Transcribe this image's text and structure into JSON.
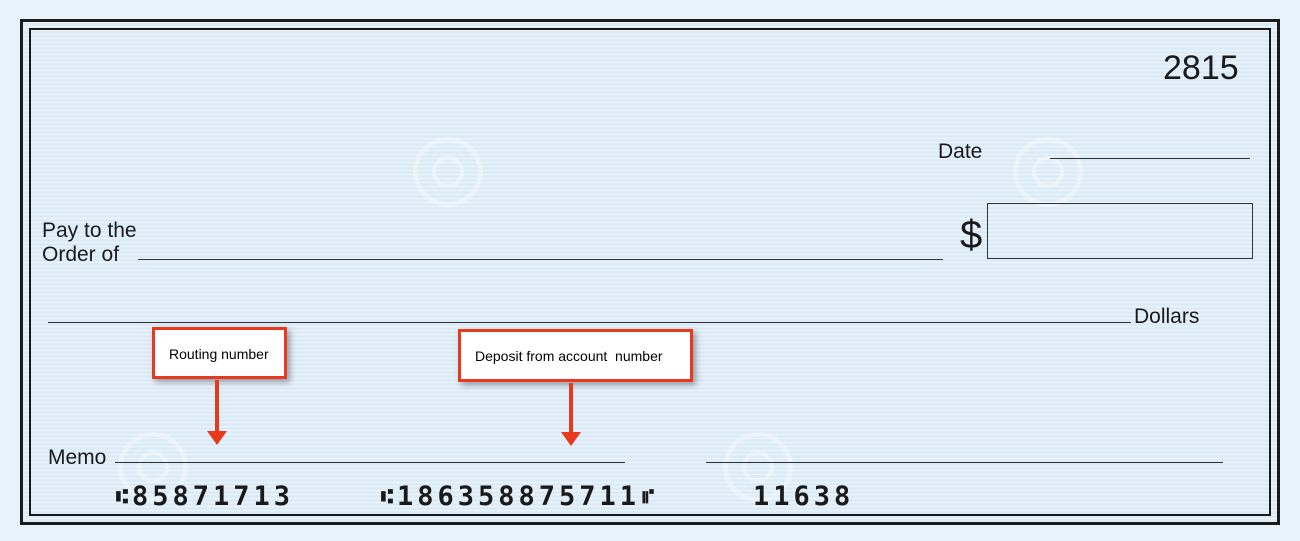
{
  "check": {
    "number": "2815",
    "date_label": "Date",
    "payee_label_line1": "Pay to the",
    "payee_label_line2": "Order of",
    "currency_symbol": "$",
    "dollars_label": "Dollars",
    "memo_label": "Memo"
  },
  "micr": {
    "routing": "85871713",
    "account": "186358875711",
    "check_number": "11638",
    "transit_symbol": "⑆",
    "on_us_symbol": "⑈"
  },
  "callouts": {
    "routing": "Routing number",
    "account": "Deposit from account  number"
  },
  "colors": {
    "page_background": "#e8f2fa",
    "check_background": "#dcebf8",
    "ink": "#1a1a1a",
    "callout_border": "#e8391c",
    "arrow": "#e8391c"
  },
  "icons": {
    "watermark": "spiral-watermark-icon"
  }
}
